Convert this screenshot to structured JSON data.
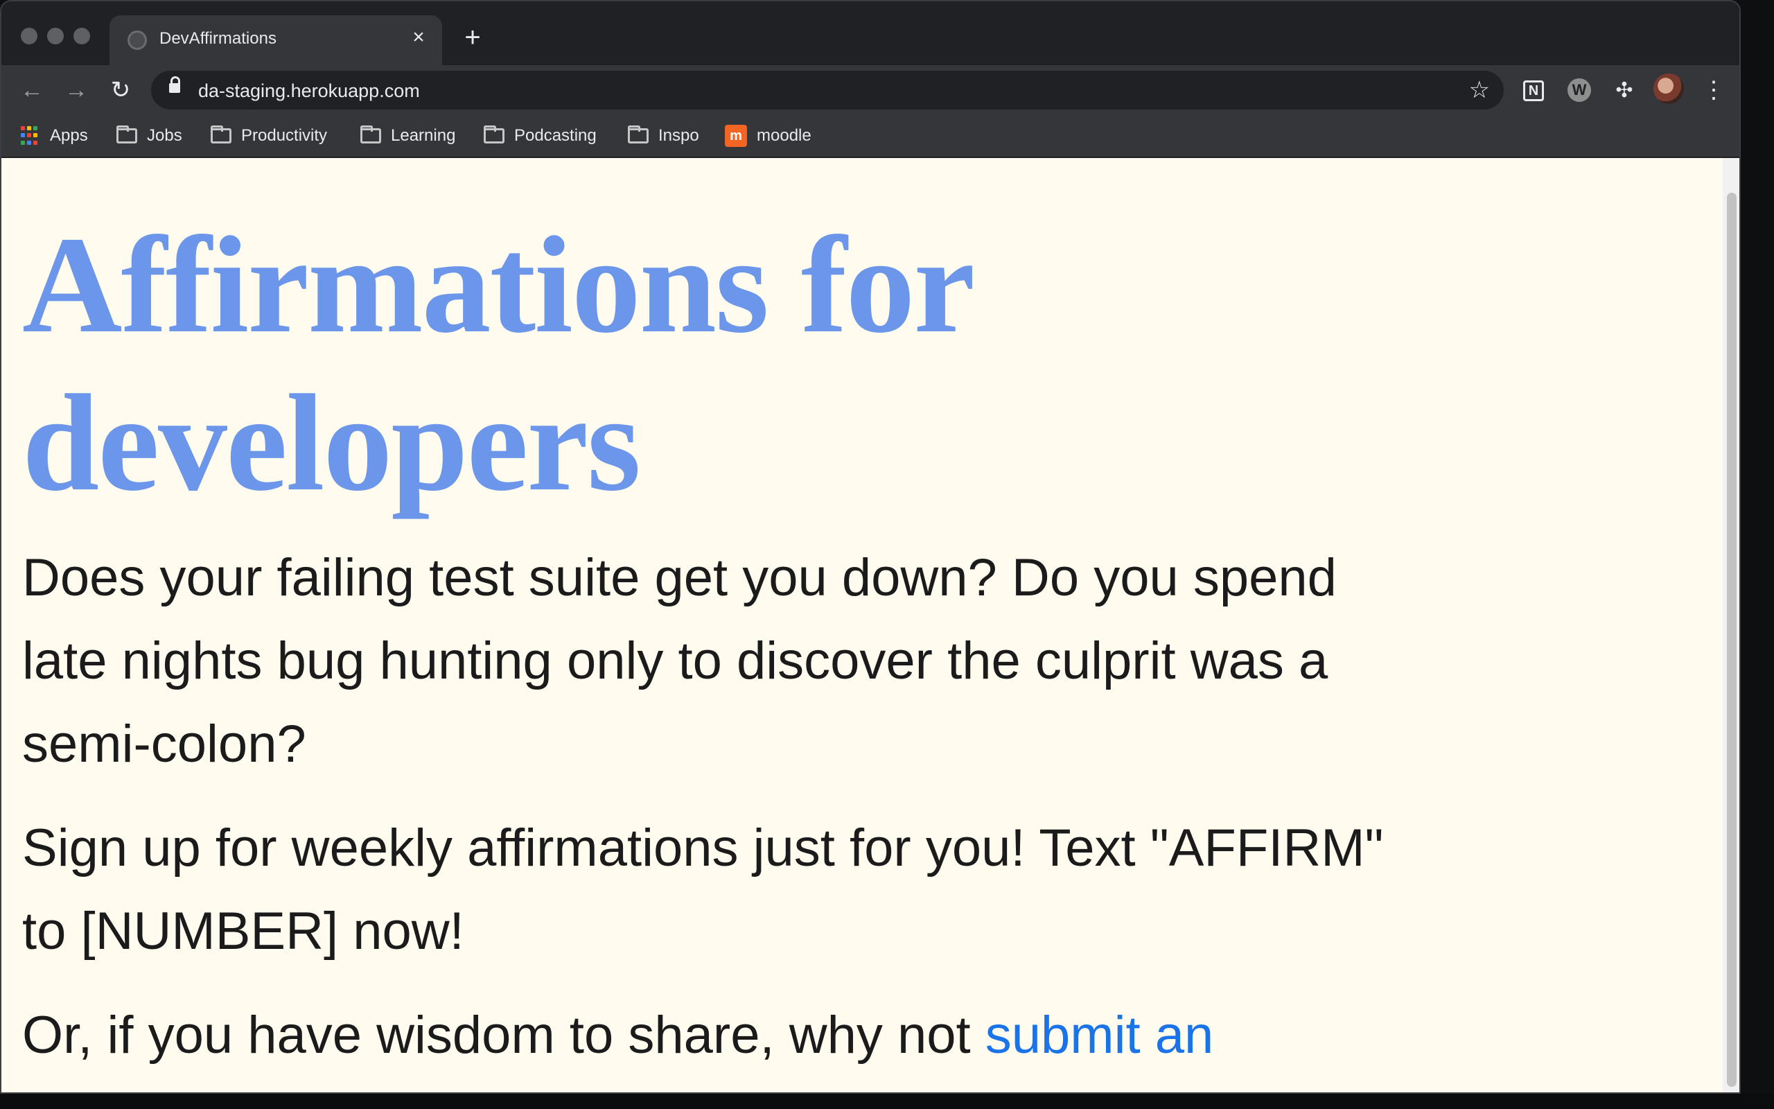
{
  "browser": {
    "tab": {
      "title": "DevAffirmations",
      "close": "×"
    },
    "new_tab": "+",
    "url": "da-staging.herokuapp.com",
    "icons": {
      "back": "←",
      "forward": "→",
      "reload": "↻",
      "star": "☆",
      "notion": "N",
      "w_ext": "W",
      "puzzle": "✣",
      "menu": "⋮"
    }
  },
  "bookmarks": [
    {
      "label": "Apps",
      "icon": "apps-icon"
    },
    {
      "label": "Jobs",
      "icon": "folder-icon"
    },
    {
      "label": "Productivity",
      "icon": "folder-icon"
    },
    {
      "label": "Learning",
      "icon": "folder-icon"
    },
    {
      "label": "Podcasting",
      "icon": "folder-icon"
    },
    {
      "label": "Inspo",
      "icon": "folder-icon"
    },
    {
      "label": "moodle",
      "icon": "moodle-icon"
    }
  ],
  "page": {
    "title": "Affirmations for developers",
    "intro": "Does your failing test suite get you down? Do you spend late nights bug hunting only to discover the culprit was a semi-colon?",
    "signup": "Sign up for weekly affirmations just for you! Text \"AFFIRM\" to [NUMBER] now!",
    "share_prefix": "Or, if you have wisdom to share, why not ",
    "share_link": "submit an affirmation",
    "share_suffix": "."
  },
  "colors": {
    "title": "#6b96ea",
    "link": "#1a73e8",
    "page_bg": "#fffbef"
  }
}
